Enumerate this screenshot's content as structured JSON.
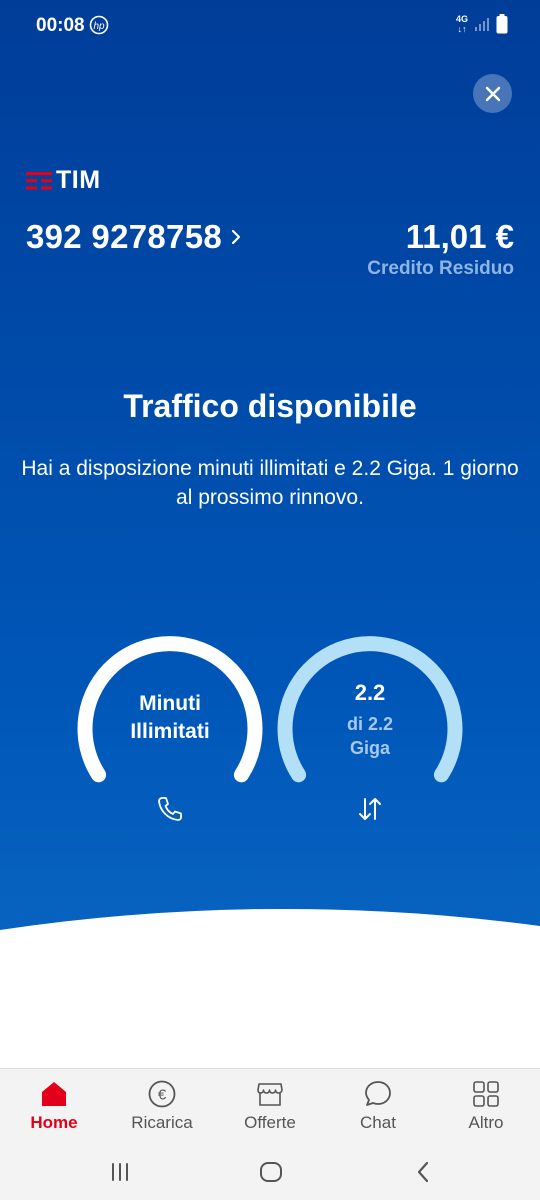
{
  "status_bar": {
    "time": "00:08",
    "network": "4G",
    "notification_icon": "hp-icon",
    "signal_icon": "signal-icon",
    "battery_icon": "battery-icon"
  },
  "header": {
    "close_icon": "close-icon",
    "brand": "TIM",
    "brand_color": "#e2001a"
  },
  "account": {
    "phone_number": "392 9278758",
    "chevron_icon": "chevron-right-icon",
    "credit_value": "11,01 €",
    "credit_label": "Credito Residuo"
  },
  "traffic": {
    "title": "Traffico disponibile",
    "description": "Hai a disposizione minuti illimitati e 2.2 Giga. 1 giorno al prossimo rinnovo.",
    "minutes_gauge": {
      "line1": "Minuti",
      "line2": "Illimitati",
      "fill_fraction": 1.0,
      "color": "#ffffff",
      "icon": "phone-icon"
    },
    "data_gauge": {
      "value": "2.2",
      "sub1": "di 2.2",
      "sub2": "Giga",
      "fill_fraction": 1.0,
      "color": "#b3e0f7",
      "icon": "transfer-arrows-icon"
    }
  },
  "bottom_nav": {
    "items": [
      {
        "label": "Home",
        "icon": "home-icon",
        "active": true
      },
      {
        "label": "Ricarica",
        "icon": "euro-icon",
        "active": false
      },
      {
        "label": "Offerte",
        "icon": "store-icon",
        "active": false
      },
      {
        "label": "Chat",
        "icon": "chat-icon",
        "active": false
      },
      {
        "label": "Altro",
        "icon": "grid-icon",
        "active": false
      }
    ]
  },
  "system_nav": {
    "recents_icon": "recents-icon",
    "home_icon": "home-circle-icon",
    "back_icon": "back-icon"
  }
}
